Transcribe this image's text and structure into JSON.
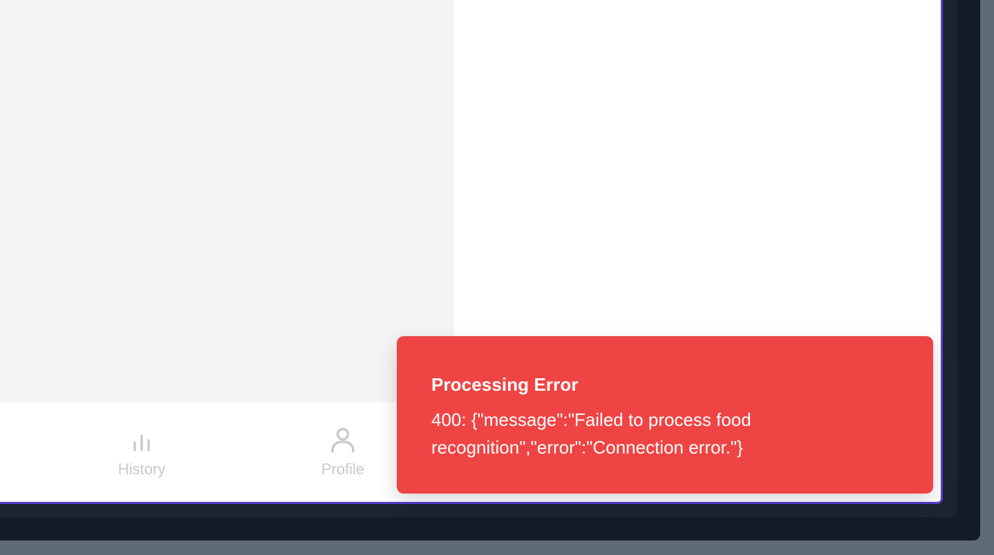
{
  "bottom_nav": {
    "items": [
      {
        "label": "History",
        "icon": "bar-chart-icon"
      },
      {
        "label": "Profile",
        "icon": "user-icon"
      }
    ]
  },
  "toast": {
    "title": "Processing Error",
    "message": "400: {\"message\":\"Failed to process food recognition\",\"error\":\"Connection error.\"}",
    "color": "#ef4444"
  },
  "colors": {
    "accent_border": "#5a3fd0",
    "device_frame": "#141b29",
    "page_background": "#5f6b75",
    "app_background": "#f4f4f4"
  }
}
